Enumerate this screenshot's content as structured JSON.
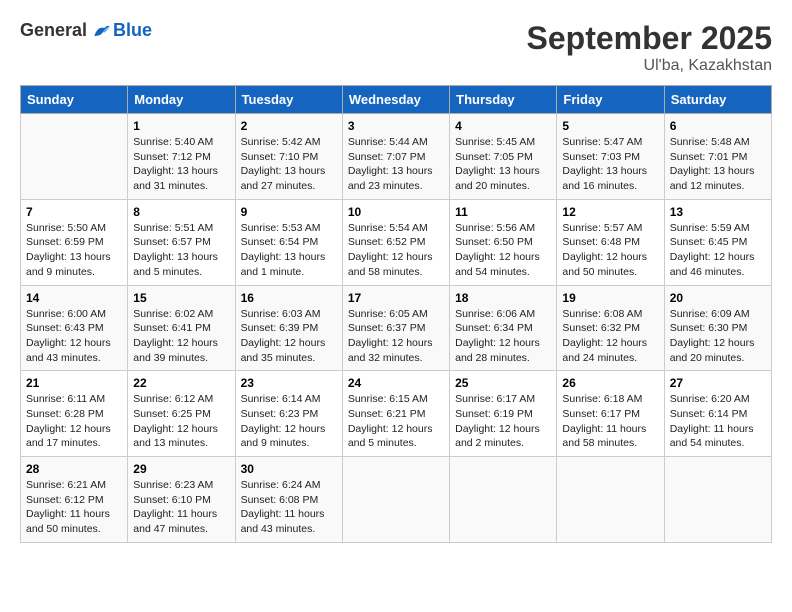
{
  "header": {
    "logo_general": "General",
    "logo_blue": "Blue",
    "month_title": "September 2025",
    "subtitle": "Ul'ba, Kazakhstan"
  },
  "columns": [
    "Sunday",
    "Monday",
    "Tuesday",
    "Wednesday",
    "Thursday",
    "Friday",
    "Saturday"
  ],
  "weeks": [
    [
      {
        "day": "",
        "sunrise": "",
        "sunset": "",
        "daylight": ""
      },
      {
        "day": "1",
        "sunrise": "Sunrise: 5:40 AM",
        "sunset": "Sunset: 7:12 PM",
        "daylight": "Daylight: 13 hours and 31 minutes."
      },
      {
        "day": "2",
        "sunrise": "Sunrise: 5:42 AM",
        "sunset": "Sunset: 7:10 PM",
        "daylight": "Daylight: 13 hours and 27 minutes."
      },
      {
        "day": "3",
        "sunrise": "Sunrise: 5:44 AM",
        "sunset": "Sunset: 7:07 PM",
        "daylight": "Daylight: 13 hours and 23 minutes."
      },
      {
        "day": "4",
        "sunrise": "Sunrise: 5:45 AM",
        "sunset": "Sunset: 7:05 PM",
        "daylight": "Daylight: 13 hours and 20 minutes."
      },
      {
        "day": "5",
        "sunrise": "Sunrise: 5:47 AM",
        "sunset": "Sunset: 7:03 PM",
        "daylight": "Daylight: 13 hours and 16 minutes."
      },
      {
        "day": "6",
        "sunrise": "Sunrise: 5:48 AM",
        "sunset": "Sunset: 7:01 PM",
        "daylight": "Daylight: 13 hours and 12 minutes."
      }
    ],
    [
      {
        "day": "7",
        "sunrise": "Sunrise: 5:50 AM",
        "sunset": "Sunset: 6:59 PM",
        "daylight": "Daylight: 13 hours and 9 minutes."
      },
      {
        "day": "8",
        "sunrise": "Sunrise: 5:51 AM",
        "sunset": "Sunset: 6:57 PM",
        "daylight": "Daylight: 13 hours and 5 minutes."
      },
      {
        "day": "9",
        "sunrise": "Sunrise: 5:53 AM",
        "sunset": "Sunset: 6:54 PM",
        "daylight": "Daylight: 13 hours and 1 minute."
      },
      {
        "day": "10",
        "sunrise": "Sunrise: 5:54 AM",
        "sunset": "Sunset: 6:52 PM",
        "daylight": "Daylight: 12 hours and 58 minutes."
      },
      {
        "day": "11",
        "sunrise": "Sunrise: 5:56 AM",
        "sunset": "Sunset: 6:50 PM",
        "daylight": "Daylight: 12 hours and 54 minutes."
      },
      {
        "day": "12",
        "sunrise": "Sunrise: 5:57 AM",
        "sunset": "Sunset: 6:48 PM",
        "daylight": "Daylight: 12 hours and 50 minutes."
      },
      {
        "day": "13",
        "sunrise": "Sunrise: 5:59 AM",
        "sunset": "Sunset: 6:45 PM",
        "daylight": "Daylight: 12 hours and 46 minutes."
      }
    ],
    [
      {
        "day": "14",
        "sunrise": "Sunrise: 6:00 AM",
        "sunset": "Sunset: 6:43 PM",
        "daylight": "Daylight: 12 hours and 43 minutes."
      },
      {
        "day": "15",
        "sunrise": "Sunrise: 6:02 AM",
        "sunset": "Sunset: 6:41 PM",
        "daylight": "Daylight: 12 hours and 39 minutes."
      },
      {
        "day": "16",
        "sunrise": "Sunrise: 6:03 AM",
        "sunset": "Sunset: 6:39 PM",
        "daylight": "Daylight: 12 hours and 35 minutes."
      },
      {
        "day": "17",
        "sunrise": "Sunrise: 6:05 AM",
        "sunset": "Sunset: 6:37 PM",
        "daylight": "Daylight: 12 hours and 32 minutes."
      },
      {
        "day": "18",
        "sunrise": "Sunrise: 6:06 AM",
        "sunset": "Sunset: 6:34 PM",
        "daylight": "Daylight: 12 hours and 28 minutes."
      },
      {
        "day": "19",
        "sunrise": "Sunrise: 6:08 AM",
        "sunset": "Sunset: 6:32 PM",
        "daylight": "Daylight: 12 hours and 24 minutes."
      },
      {
        "day": "20",
        "sunrise": "Sunrise: 6:09 AM",
        "sunset": "Sunset: 6:30 PM",
        "daylight": "Daylight: 12 hours and 20 minutes."
      }
    ],
    [
      {
        "day": "21",
        "sunrise": "Sunrise: 6:11 AM",
        "sunset": "Sunset: 6:28 PM",
        "daylight": "Daylight: 12 hours and 17 minutes."
      },
      {
        "day": "22",
        "sunrise": "Sunrise: 6:12 AM",
        "sunset": "Sunset: 6:25 PM",
        "daylight": "Daylight: 12 hours and 13 minutes."
      },
      {
        "day": "23",
        "sunrise": "Sunrise: 6:14 AM",
        "sunset": "Sunset: 6:23 PM",
        "daylight": "Daylight: 12 hours and 9 minutes."
      },
      {
        "day": "24",
        "sunrise": "Sunrise: 6:15 AM",
        "sunset": "Sunset: 6:21 PM",
        "daylight": "Daylight: 12 hours and 5 minutes."
      },
      {
        "day": "25",
        "sunrise": "Sunrise: 6:17 AM",
        "sunset": "Sunset: 6:19 PM",
        "daylight": "Daylight: 12 hours and 2 minutes."
      },
      {
        "day": "26",
        "sunrise": "Sunrise: 6:18 AM",
        "sunset": "Sunset: 6:17 PM",
        "daylight": "Daylight: 11 hours and 58 minutes."
      },
      {
        "day": "27",
        "sunrise": "Sunrise: 6:20 AM",
        "sunset": "Sunset: 6:14 PM",
        "daylight": "Daylight: 11 hours and 54 minutes."
      }
    ],
    [
      {
        "day": "28",
        "sunrise": "Sunrise: 6:21 AM",
        "sunset": "Sunset: 6:12 PM",
        "daylight": "Daylight: 11 hours and 50 minutes."
      },
      {
        "day": "29",
        "sunrise": "Sunrise: 6:23 AM",
        "sunset": "Sunset: 6:10 PM",
        "daylight": "Daylight: 11 hours and 47 minutes."
      },
      {
        "day": "30",
        "sunrise": "Sunrise: 6:24 AM",
        "sunset": "Sunset: 6:08 PM",
        "daylight": "Daylight: 11 hours and 43 minutes."
      },
      {
        "day": "",
        "sunrise": "",
        "sunset": "",
        "daylight": ""
      },
      {
        "day": "",
        "sunrise": "",
        "sunset": "",
        "daylight": ""
      },
      {
        "day": "",
        "sunrise": "",
        "sunset": "",
        "daylight": ""
      },
      {
        "day": "",
        "sunrise": "",
        "sunset": "",
        "daylight": ""
      }
    ]
  ]
}
